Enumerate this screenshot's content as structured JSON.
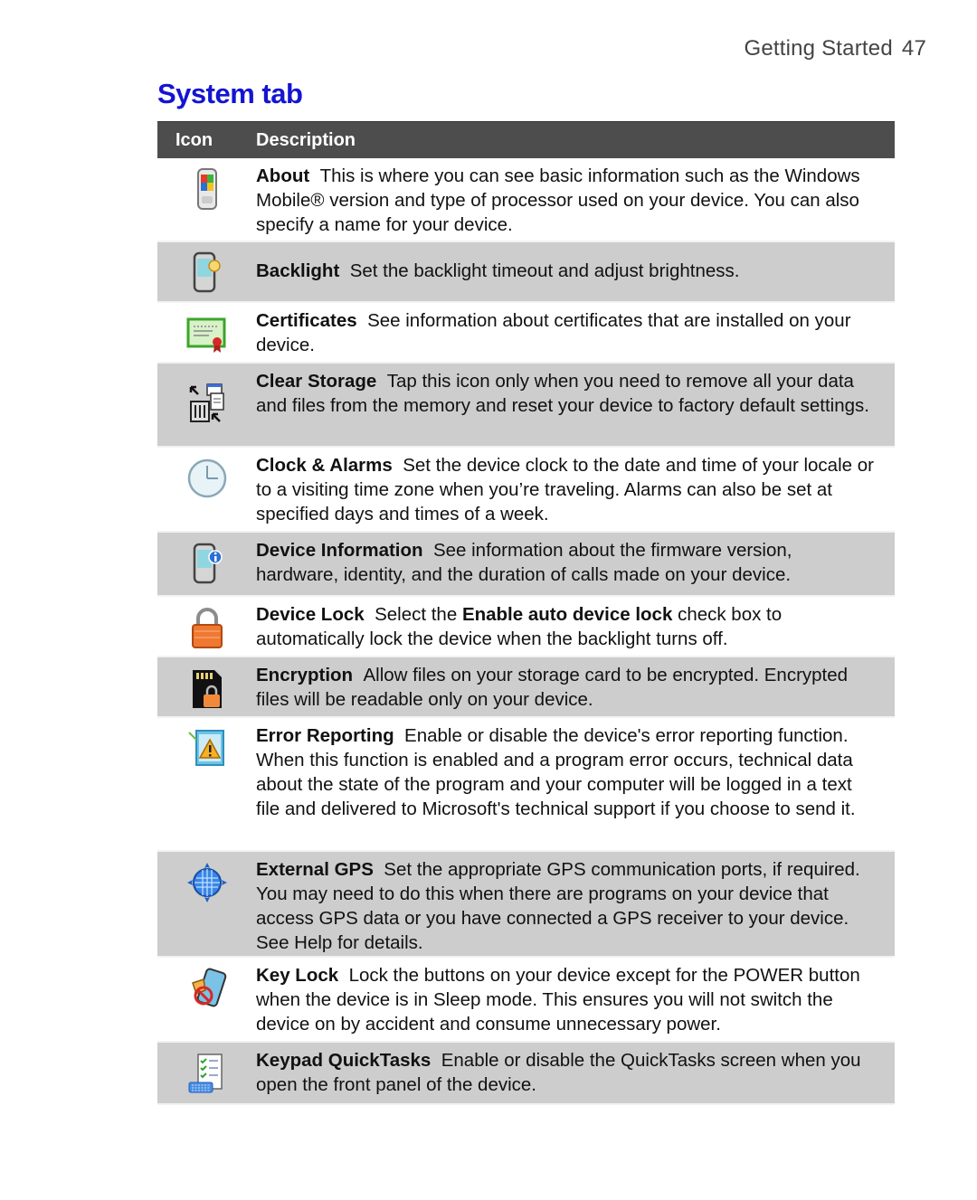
{
  "header": {
    "section": "Getting Started",
    "page_number": "47"
  },
  "title": "System tab",
  "table": {
    "columns": [
      "Icon",
      "Description"
    ],
    "rows": [
      {
        "icon": "about-icon",
        "name": "About",
        "text": "This is where you can see basic information such as the Windows Mobile® version and type of processor used on your device. You can also specify a name for your device."
      },
      {
        "icon": "backlight-icon",
        "name": "Backlight",
        "text": "Set the backlight timeout and adjust brightness."
      },
      {
        "icon": "certificates-icon",
        "name": "Certificates",
        "text": "See information about certificates that are installed on your device."
      },
      {
        "icon": "clear-storage-icon",
        "name": "Clear Storage",
        "text": "Tap this icon only when you need to remove all your data and files from the memory and reset your device to factory default settings."
      },
      {
        "icon": "clock-icon",
        "name": "Clock & Alarms",
        "text": "Set the device clock to the date and time of your locale or to a visiting time zone when you’re traveling. Alarms can also be set at specified days and times of a week."
      },
      {
        "icon": "device-information-icon",
        "name": "Device Information",
        "text": "See information about the firmware version, hardware, identity, and the duration of calls made on your device."
      },
      {
        "icon": "device-lock-icon",
        "name": "Device Lock",
        "text_before": "Select the",
        "bold_inline": "Enable auto device lock",
        "text_after": "check box to automatically lock the device when the backlight turns off."
      },
      {
        "icon": "encryption-icon",
        "name": "Encryption",
        "text": "Allow files on your storage card to be encrypted. Encrypted files will be readable only on your device."
      },
      {
        "icon": "error-reporting-icon",
        "name": "Error Reporting",
        "text": "Enable or disable the device's error reporting function. When this function is enabled and a program error occurs, technical data about the state of the program and your computer will be logged in a text file and delivered to Microsoft's technical support if you choose to send it."
      },
      {
        "icon": "external-gps-icon",
        "name": "External GPS",
        "text": "Set the appropriate GPS communication ports, if required. You may need to do this when there are programs on your device that access GPS data or you have connected a GPS receiver to your device. See Help for details."
      },
      {
        "icon": "key-lock-icon",
        "name": "Key Lock",
        "text": "Lock the buttons on your device except for the POWER button when the device is in Sleep mode. This ensures you will not switch the device on by accident and consume unnecessary power."
      },
      {
        "icon": "keypad-quicktasks-icon",
        "name": "Keypad QuickTasks",
        "text": "Enable or disable the QuickTasks screen when you open the front panel of the device."
      }
    ]
  }
}
